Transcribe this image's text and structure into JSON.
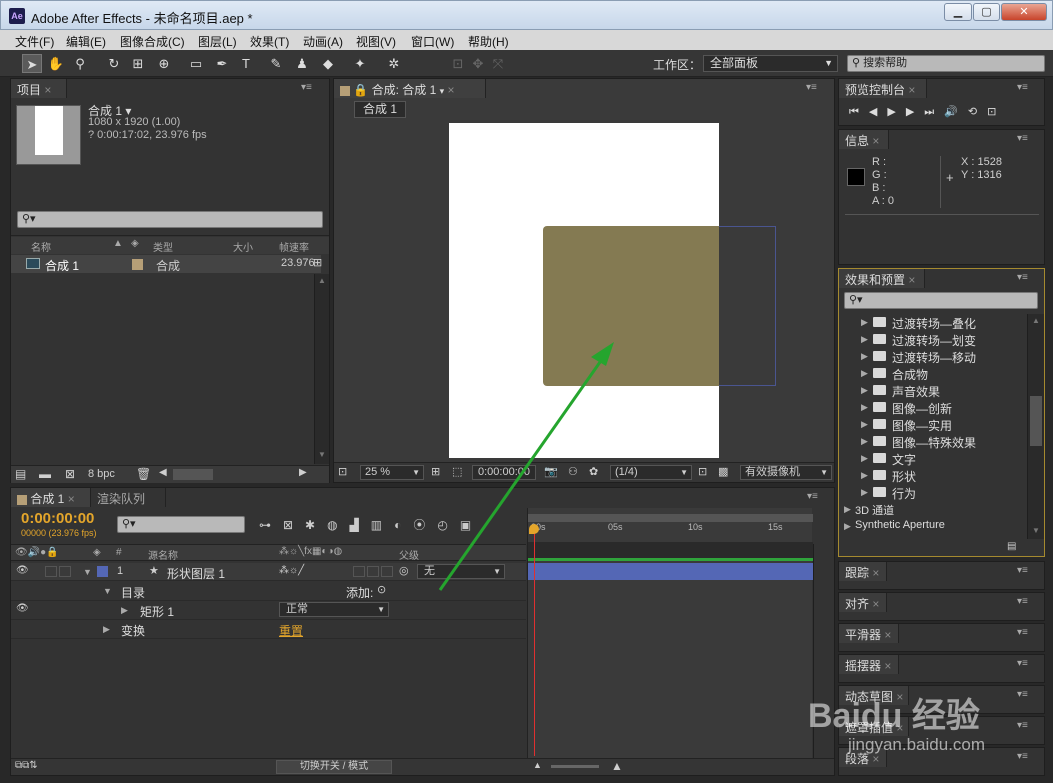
{
  "app": {
    "logo": "Ae",
    "title": "Adobe After Effects - 未命名项目.aep *",
    "minimize": "▁",
    "maximize": "▢",
    "close": "✕"
  },
  "menu": [
    "文件(F)",
    "编辑(E)",
    "图像合成(C)",
    "图层(L)",
    "效果(T)",
    "动画(A)",
    "视图(V)",
    "窗口(W)",
    "帮助(H)"
  ],
  "toolbar": {
    "workspace_label": "工作区：",
    "workspace_value": "全部面板",
    "search_placeholder": "搜索帮助"
  },
  "project": {
    "tab": "项目",
    "comp_name": "合成 1 ▾",
    "resolution": "1080 x 1920 (1.00)",
    "duration": "? 0:00:17:02, 23.976 fps",
    "search_icon": "⚲▾",
    "columns": [
      "名称",
      "类型",
      "大小",
      "帧速率"
    ],
    "rows": [
      {
        "name": "合成 1",
        "type": "合成",
        "fps": "23.976"
      }
    ],
    "bpc": "8 bpc",
    "label_color": "#b69f77"
  },
  "composition": {
    "tab": "合成: 合成 1",
    "subtab": "合成 1",
    "zoom": "25 %",
    "timecode": "0:00:00:00",
    "resolution": "(1/4)",
    "camera": "有效摄像机",
    "shape_color": "#847a52"
  },
  "preview": {
    "tab": "预览控制台"
  },
  "info": {
    "tab": "信息",
    "r": "R :",
    "g": "G :",
    "b": "B :",
    "a": "A : 0",
    "x": "X : 1528",
    "y": "Y : 1316"
  },
  "effects": {
    "tab": "效果和预置",
    "items": [
      "过渡转场—叠化",
      "过渡转场—划变",
      "过渡转场—移动",
      "合成物",
      "声音效果",
      "图像—创新",
      "图像—实用",
      "图像—特殊效果",
      "文字",
      "形状",
      "行为"
    ],
    "top_items": [
      "3D 通道",
      "Synthetic Aperture"
    ]
  },
  "right_panels": [
    "跟踪",
    "对齐",
    "平滑器",
    "摇摆器",
    "动态草图",
    "遮罩插值",
    "段落"
  ],
  "timeline": {
    "tab": "合成 1",
    "tab2": "渲染队列",
    "timecode": "0:00:00:00",
    "frames": "00000 (23.976 fps)",
    "columns": {
      "name": "源名称",
      "num": "#",
      "parent": "父级"
    },
    "layer": {
      "num": "1",
      "name": "形状图层 1",
      "parent": "无"
    },
    "contents": "目录",
    "add": "添加:",
    "rect": "矩形 1",
    "mode": "正常",
    "transform": "变换",
    "reset": "重置",
    "ruler": [
      "00s",
      "05s",
      "10s",
      "15s"
    ],
    "toggle_modes": "切换开关 / 模式",
    "layer_color": "#5467b5"
  },
  "watermark": {
    "main": "Baidu 经验",
    "url": "jingyan.baidu.com"
  }
}
